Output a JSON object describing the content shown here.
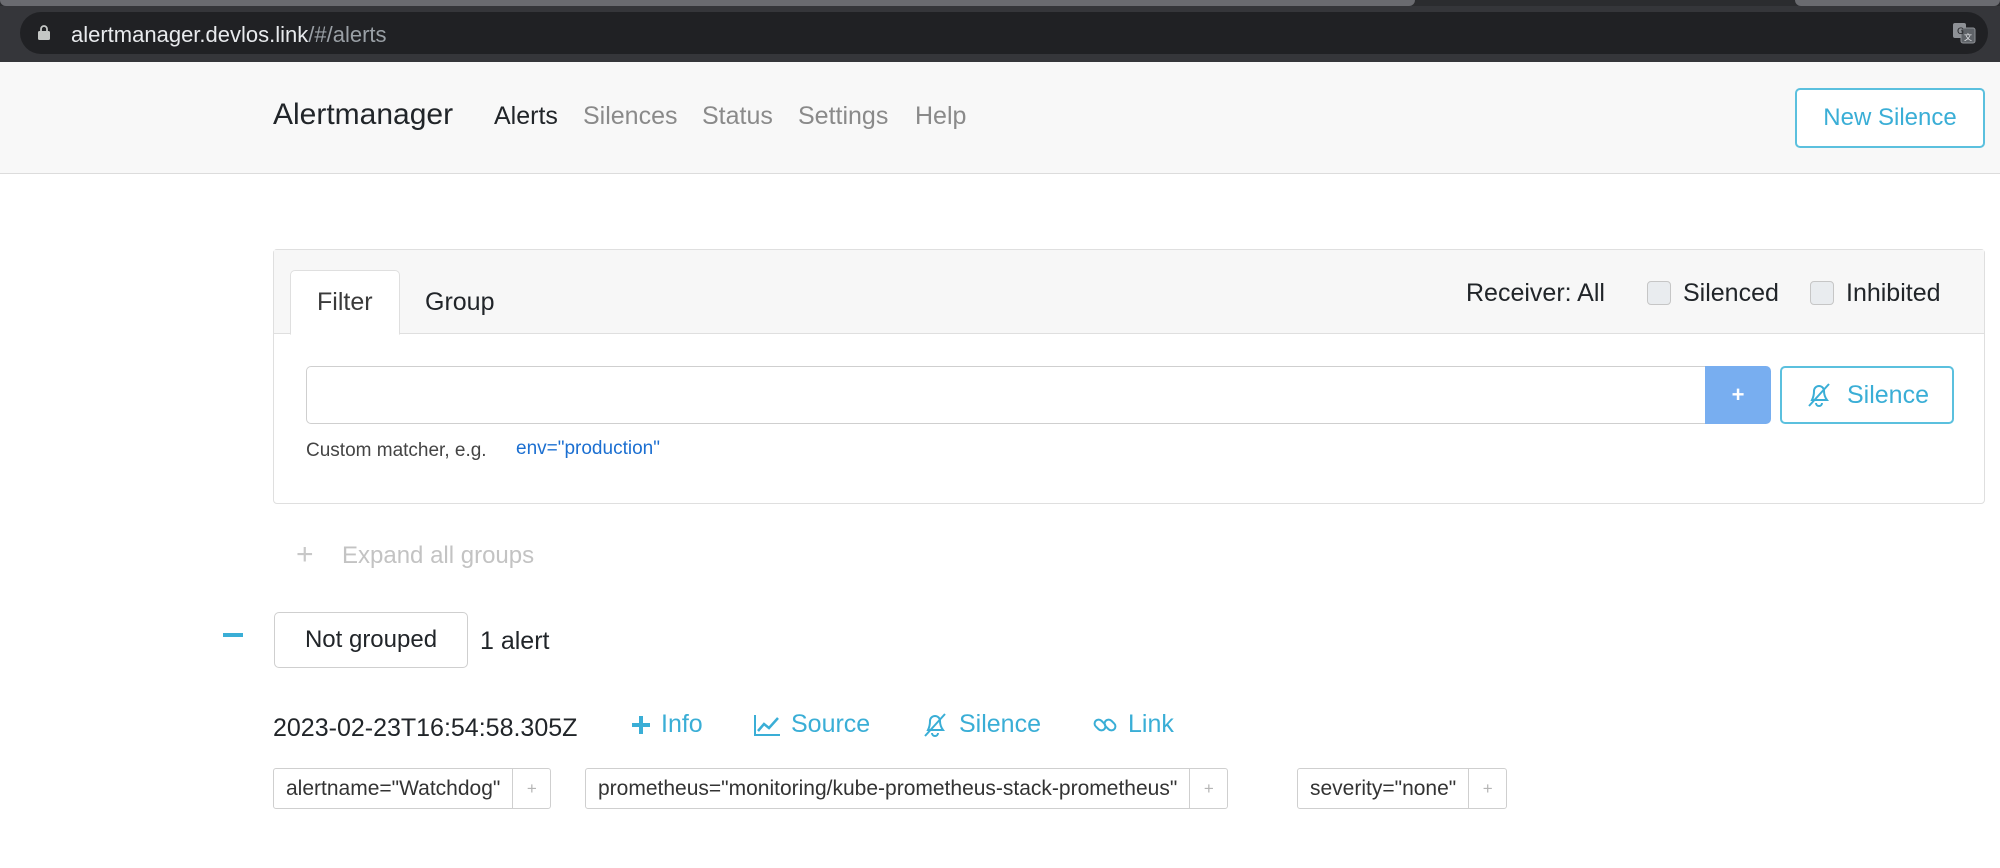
{
  "browser": {
    "url_host": "alertmanager.devlos.link",
    "url_path": "/#/alerts"
  },
  "navbar": {
    "brand": "Alertmanager",
    "items": [
      {
        "label": "Alerts",
        "active": true
      },
      {
        "label": "Silences",
        "active": false
      },
      {
        "label": "Status",
        "active": false
      },
      {
        "label": "Settings",
        "active": false
      },
      {
        "label": "Help",
        "active": false
      }
    ],
    "new_silence": "New Silence"
  },
  "filter": {
    "tabs": [
      "Filter",
      "Group"
    ],
    "receiver": "Receiver: All",
    "silenced_label": "Silenced",
    "inhibited_label": "Inhibited",
    "input_value": "",
    "add_label": "+",
    "silence_label": "Silence",
    "hint": "Custom matcher, e.g.",
    "hint_example": "env=\"production\""
  },
  "expand_all": "Expand all groups",
  "group": {
    "name": "Not grouped",
    "count": "1 alert"
  },
  "alert": {
    "time": "2023-02-23T16:54:58.305Z",
    "actions": {
      "info": "Info",
      "source": "Source",
      "silence": "Silence",
      "link": "Link"
    },
    "labels": [
      "alertname=\"Watchdog\"",
      "prometheus=\"monitoring/kube-prometheus-stack-prometheus\"",
      "severity=\"none\""
    ],
    "label_add": "+"
  },
  "colors": {
    "accent": "#3aaed6",
    "add_button": "#78aef0",
    "link_blue": "#1b6fd1"
  }
}
